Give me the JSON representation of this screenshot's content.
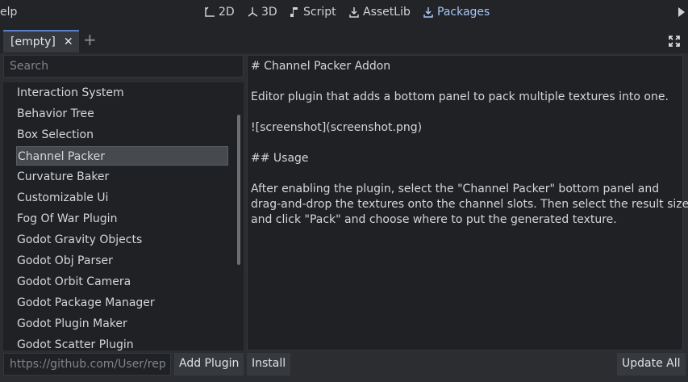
{
  "topbar": {
    "help_menu": "elp",
    "workspaces": [
      "2D",
      "3D",
      "Script",
      "AssetLib",
      "Packages"
    ],
    "active_workspace": "Packages"
  },
  "tab": {
    "label": "[empty]"
  },
  "search": {
    "placeholder": "Search"
  },
  "plugins": [
    "Interaction System",
    "Behavior Tree",
    "Box Selection",
    "Channel Packer",
    "Curvature Baker",
    "Customizable Ui",
    "Fog Of War Plugin",
    "Godot Gravity Objects",
    "Godot Obj Parser",
    "Godot Orbit Camera",
    "Godot Package Manager",
    "Godot Plugin Maker",
    "Godot Scatter Plugin"
  ],
  "selected_plugin": "Channel Packer",
  "readme": [
    "# Channel Packer Addon",
    "",
    "Editor plugin that adds a bottom panel to pack multiple textures into one.",
    "",
    "![screenshot](screenshot.png)",
    "",
    "## Usage",
    "",
    "After enabling the plugin, select the \"Channel Packer\" bottom panel and",
    "drag-and-drop the textures onto the channel slots. Then select the result size,",
    "and click \"Pack\" and choose where to put the generated texture."
  ],
  "bottom": {
    "url_placeholder": "https://github.com/User/rep",
    "add_plugin": "Add Plugin",
    "install": "Install",
    "update_all": "Update All"
  },
  "colors": {
    "accent": "#a9c6f3",
    "panel": "#1f2125",
    "selection": "#46494e"
  }
}
